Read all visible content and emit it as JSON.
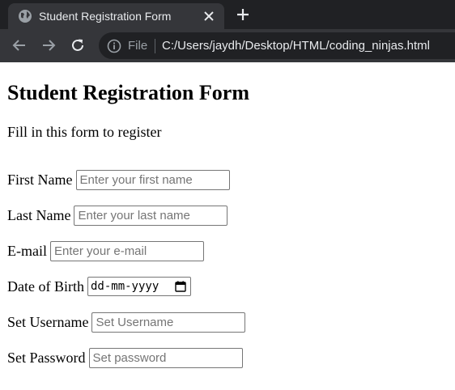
{
  "browser": {
    "tab_title": "Student Registration Form",
    "file_label": "File",
    "url": "C:/Users/jaydh/Desktop/HTML/coding_ninjas.html",
    "icons": {
      "favicon": "globe-icon",
      "close": "close-icon",
      "new_tab": "plus-icon",
      "back": "back-arrow-icon",
      "forward": "forward-arrow-icon",
      "reload": "reload-icon",
      "info": "info-icon"
    },
    "colors": {
      "tabstrip_bg": "#202124",
      "tab_bg": "#35363a",
      "text": "#e8eaed",
      "muted": "#9aa0a6"
    }
  },
  "page": {
    "title": "Student Registration Form",
    "subtitle": "Fill in this form to register"
  },
  "form": {
    "fields": [
      {
        "label": "First Name",
        "placeholder": "Enter your first name",
        "value": ""
      },
      {
        "label": "Last Name",
        "placeholder": "Enter your last name",
        "value": ""
      },
      {
        "label": "E-mail",
        "placeholder": "Enter your e-mail",
        "value": ""
      },
      {
        "label": "Date of Birth",
        "placeholder": "dd-mm-yyyy",
        "value": ""
      },
      {
        "label": "Set Username",
        "placeholder": "Set Username",
        "value": ""
      },
      {
        "label": "Set Password",
        "placeholder": "Set password",
        "value": ""
      }
    ]
  }
}
